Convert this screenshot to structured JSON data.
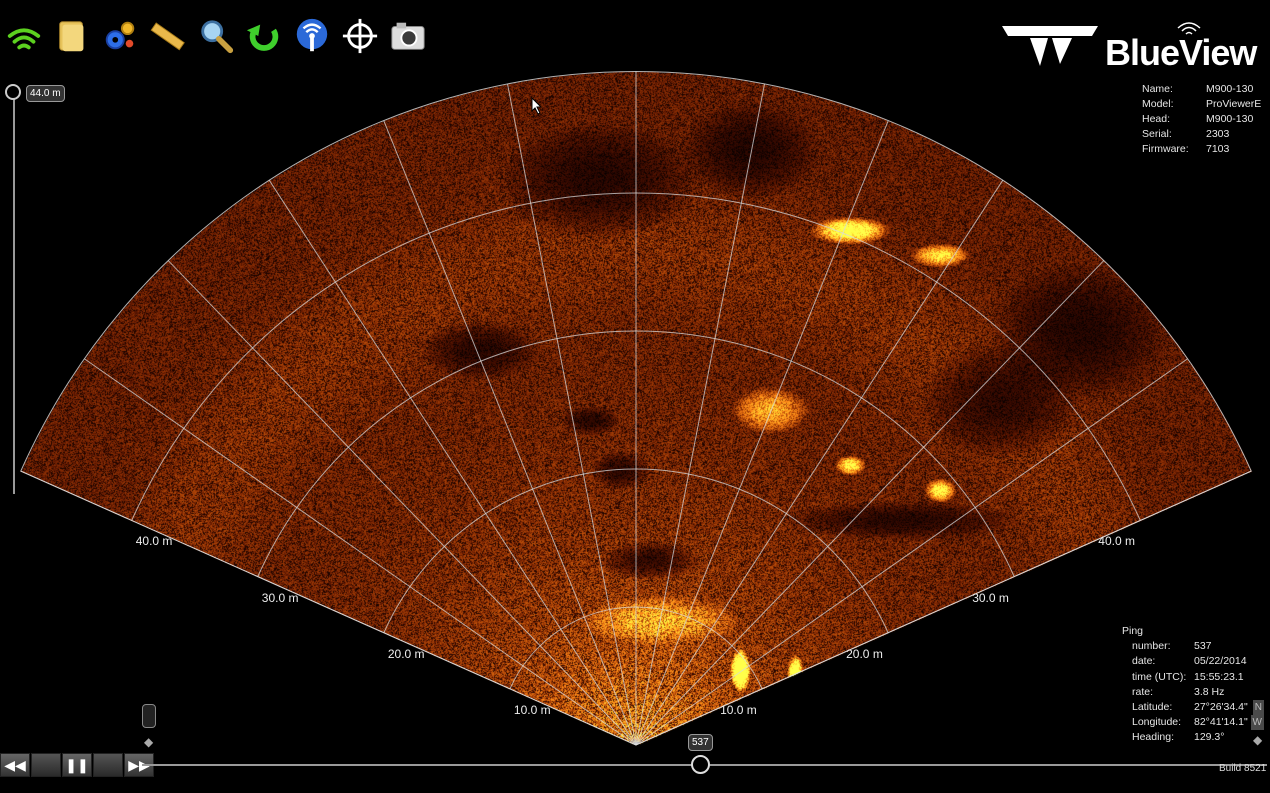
{
  "app": {
    "brand": "BlueView"
  },
  "toolbar": {
    "icons": [
      "wifi-connect-icon",
      "folder-icon",
      "settings-gears-icon",
      "ruler-icon",
      "magnifier-icon",
      "refresh-icon",
      "broadcast-icon",
      "crosshair-icon",
      "camera-icon"
    ]
  },
  "sensor_info": {
    "rows": [
      {
        "label": "Name:",
        "value": "M900-130"
      },
      {
        "label": "Model:",
        "value": "ProViewerE"
      },
      {
        "label": "Head:",
        "value": "M900-130"
      },
      {
        "label": "Serial:",
        "value": "2303"
      },
      {
        "label": "Firmware:",
        "value": "7103"
      }
    ]
  },
  "ping": {
    "title": "Ping",
    "rows": [
      {
        "label": "number:",
        "value": "537"
      },
      {
        "label": "date:",
        "value": "05/22/2014"
      },
      {
        "label": "time (UTC):",
        "value": "15:55:23.1"
      },
      {
        "label": "rate:",
        "value": "3.8 Hz"
      },
      {
        "label": "Latitude:",
        "value": "27°26'34.4\"",
        "dir": "N"
      },
      {
        "label": "Longitude:",
        "value": "82°41'14.1\"",
        "dir": "W"
      },
      {
        "label": "Heading:",
        "value": "129.3°"
      }
    ]
  },
  "range": {
    "max_badge": "44.0 m",
    "labels": [
      "10.0 m",
      "20.0 m",
      "30.0 m",
      "40.0 m"
    ]
  },
  "playback": {
    "ping_badge": "537",
    "build": "Build 8521",
    "rewind": "◀◀",
    "pause": "❚❚",
    "forward": "▶▶"
  }
}
